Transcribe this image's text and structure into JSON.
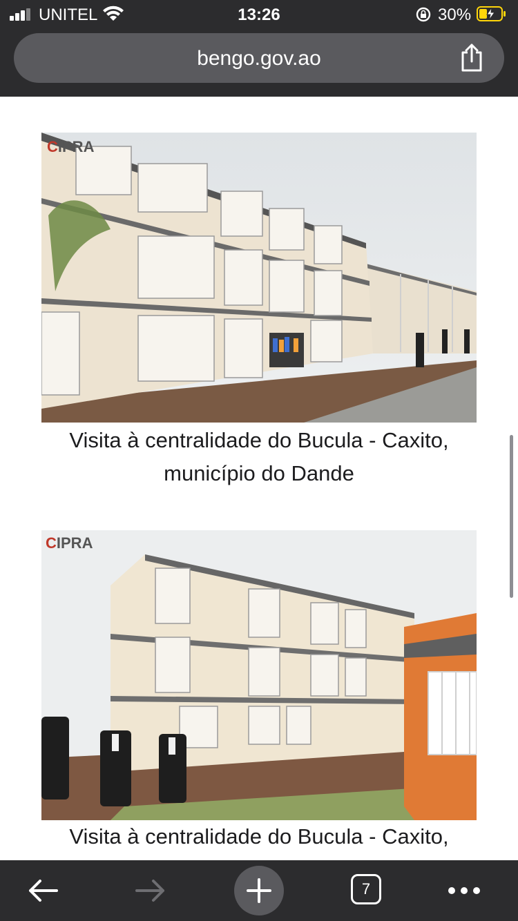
{
  "status_bar": {
    "carrier": "UNITEL",
    "time": "13:26",
    "battery_percent": "30%",
    "icons": [
      "signal-icon",
      "wifi-icon",
      "orientation-lock-icon",
      "battery-charging-icon"
    ]
  },
  "browser": {
    "url": "bengo.gov.ao",
    "tab_count": "7",
    "toolbar_icons": [
      "back-arrow-icon",
      "forward-arrow-icon",
      "new-tab-plus-icon",
      "tabs-icon",
      "more-icon"
    ]
  },
  "articles": [
    {
      "image_logo": "CIPRA",
      "caption": "Visita à centralidade do Bucula - Caxito, município do Dande"
    },
    {
      "image_logo": "CIPRA",
      "caption": "Visita à centralidade do Bucula - Caxito,"
    }
  ],
  "colors": {
    "bar": "#2c2c2e",
    "urlbar": "#5a5a5e",
    "battery": "#ffd60a",
    "accent_building": "#e07a35"
  }
}
